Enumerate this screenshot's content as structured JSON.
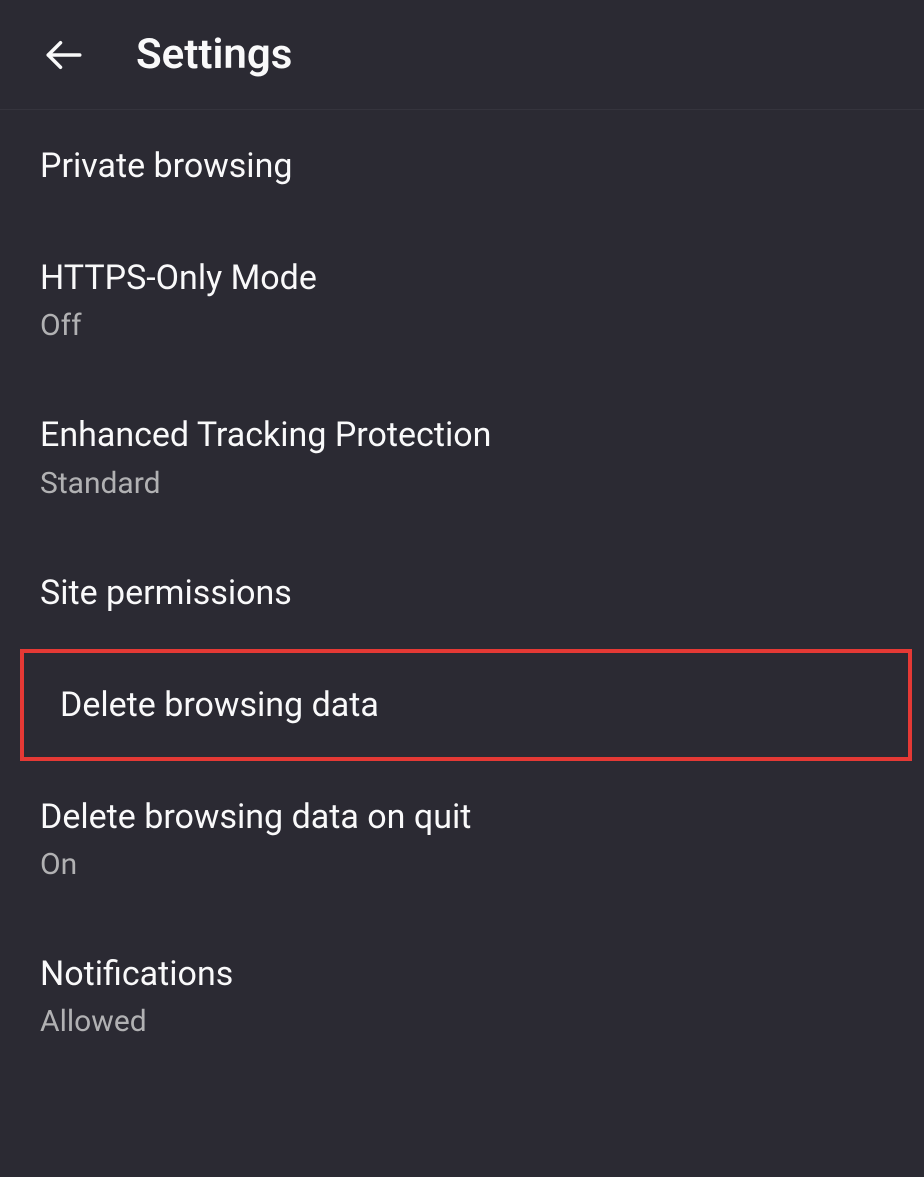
{
  "header": {
    "title": "Settings"
  },
  "settings": [
    {
      "title": "Private browsing",
      "subtitle": null,
      "highlighted": false
    },
    {
      "title": "HTTPS-Only Mode",
      "subtitle": "Off",
      "highlighted": false
    },
    {
      "title": "Enhanced Tracking Protection",
      "subtitle": "Standard",
      "highlighted": false
    },
    {
      "title": "Site permissions",
      "subtitle": null,
      "highlighted": false
    },
    {
      "title": "Delete browsing data",
      "subtitle": null,
      "highlighted": true
    },
    {
      "title": "Delete browsing data on quit",
      "subtitle": "On",
      "highlighted": false
    },
    {
      "title": "Notifications",
      "subtitle": "Allowed",
      "highlighted": false
    }
  ]
}
